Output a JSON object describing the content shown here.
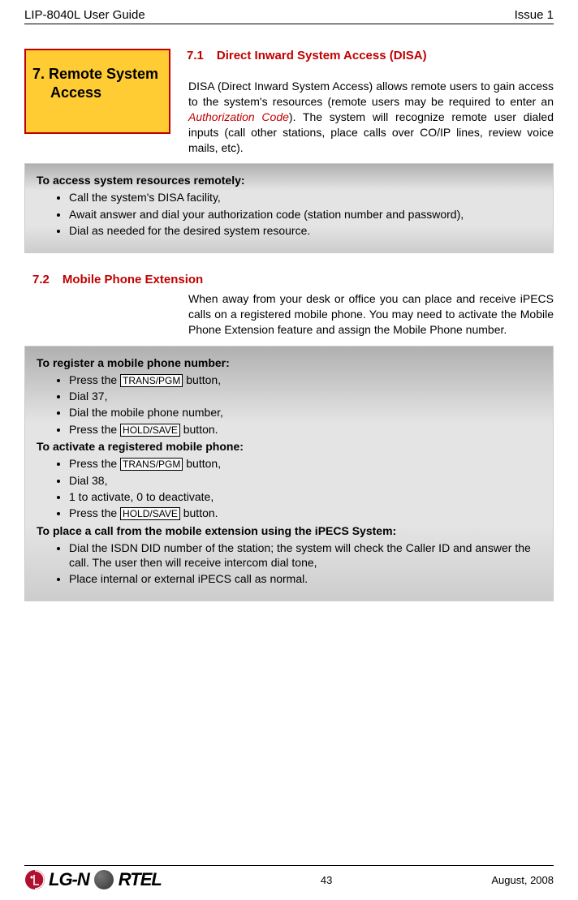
{
  "header": {
    "left": "LIP-8040L User Guide",
    "right": "Issue 1"
  },
  "remote_box": {
    "line1": "7. Remote System",
    "line2": "Access"
  },
  "sec71": {
    "num": "7.1",
    "title": "Direct Inward System Access (DISA)",
    "pre": "DISA (Direct Inward System Access) allows remote users to gain access to the system's resources (remote users may be required to enter an",
    "auth": " Authorization Code",
    "post": "). The system will recognize remote user dialed inputs (call other stations, place calls over CO/IP lines, review voice mails, etc)."
  },
  "box1": {
    "head": "To access system resources remotely:",
    "b1": "Call the system's DISA facility,",
    "b2": "Await answer and dial your authorization code (station number and password),",
    "b3": "Dial as needed for the desired system resource."
  },
  "sec72": {
    "num": "7.2",
    "title": "Mobile Phone Extension",
    "body": "When away from your desk or office you can place and receive iPECS calls on a registered mobile phone.  You may need to activate the Mobile Phone Extension feature and assign the Mobile Phone number."
  },
  "box2": {
    "h1": "To register a mobile phone number:",
    "a1_pre": "Press the ",
    "key_trans": "TRANS/PGM",
    "a1_post": " button,",
    "a2": "Dial 37,",
    "a3": "Dial the mobile phone number,",
    "a4_pre": "Press the ",
    "key_hold": "HOLD/SAVE",
    "a4_post": " button.",
    "h2": "To activate a registered mobile phone:",
    "b2": "Dial 38,",
    "b3": "1 to activate, 0 to deactivate,",
    "h3": "To place a call from the mobile extension using the iPECS System:",
    "c1": "Dial the ISDN DID number of the station; the system will check the Caller ID and answer the call. The user then will receive intercom dial tone,",
    "c2": "Place internal or external iPECS call as normal."
  },
  "footer": {
    "logo_left": "LG-N",
    "logo_right": "RTEL",
    "pagenum": "43",
    "date": "August, 2008"
  }
}
